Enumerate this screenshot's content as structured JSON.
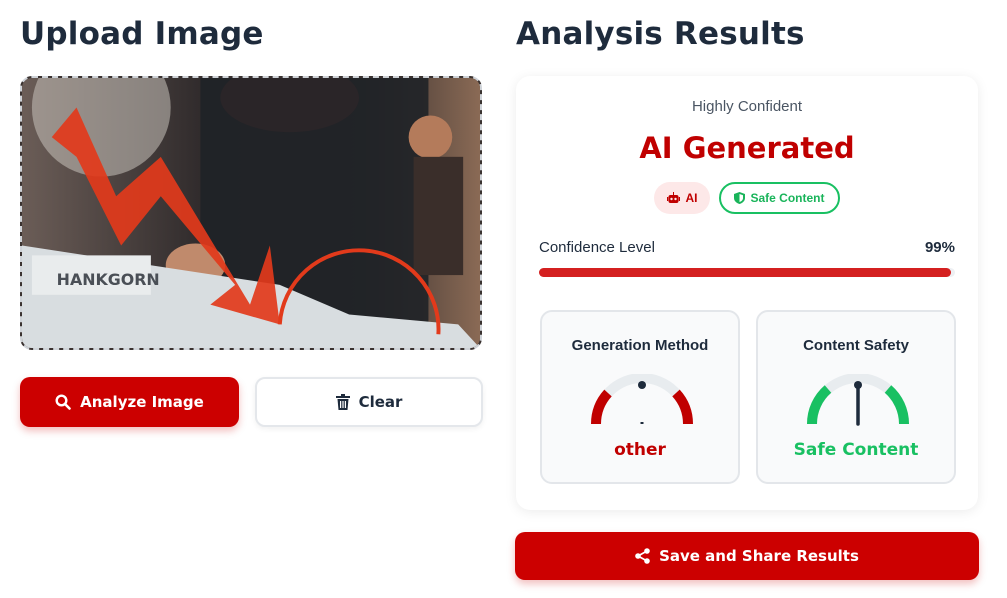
{
  "upload": {
    "title": "Upload Image",
    "analyze_label": "Analyze Image",
    "clear_label": "Clear"
  },
  "results": {
    "title": "Analysis Results",
    "confidence_text": "Highly Confident",
    "verdict": "AI Generated",
    "badges": {
      "ai": "AI",
      "safe": "Safe Content"
    },
    "confidence": {
      "label": "Confidence Level",
      "value_text": "99%",
      "fraction": 0.99
    },
    "generation": {
      "title": "Generation Method",
      "value": "other"
    },
    "safety": {
      "title": "Content Safety",
      "value": "Safe Content"
    },
    "share_label": "Save and Share Results"
  },
  "preview_image_text": "HANKGORN",
  "colors": {
    "accent": "#cc0000",
    "safe": "#19c062",
    "text": "#1e2b3c"
  },
  "icons": [
    "search-icon",
    "trash-icon",
    "robot-icon",
    "shield-icon",
    "share-icon"
  ]
}
